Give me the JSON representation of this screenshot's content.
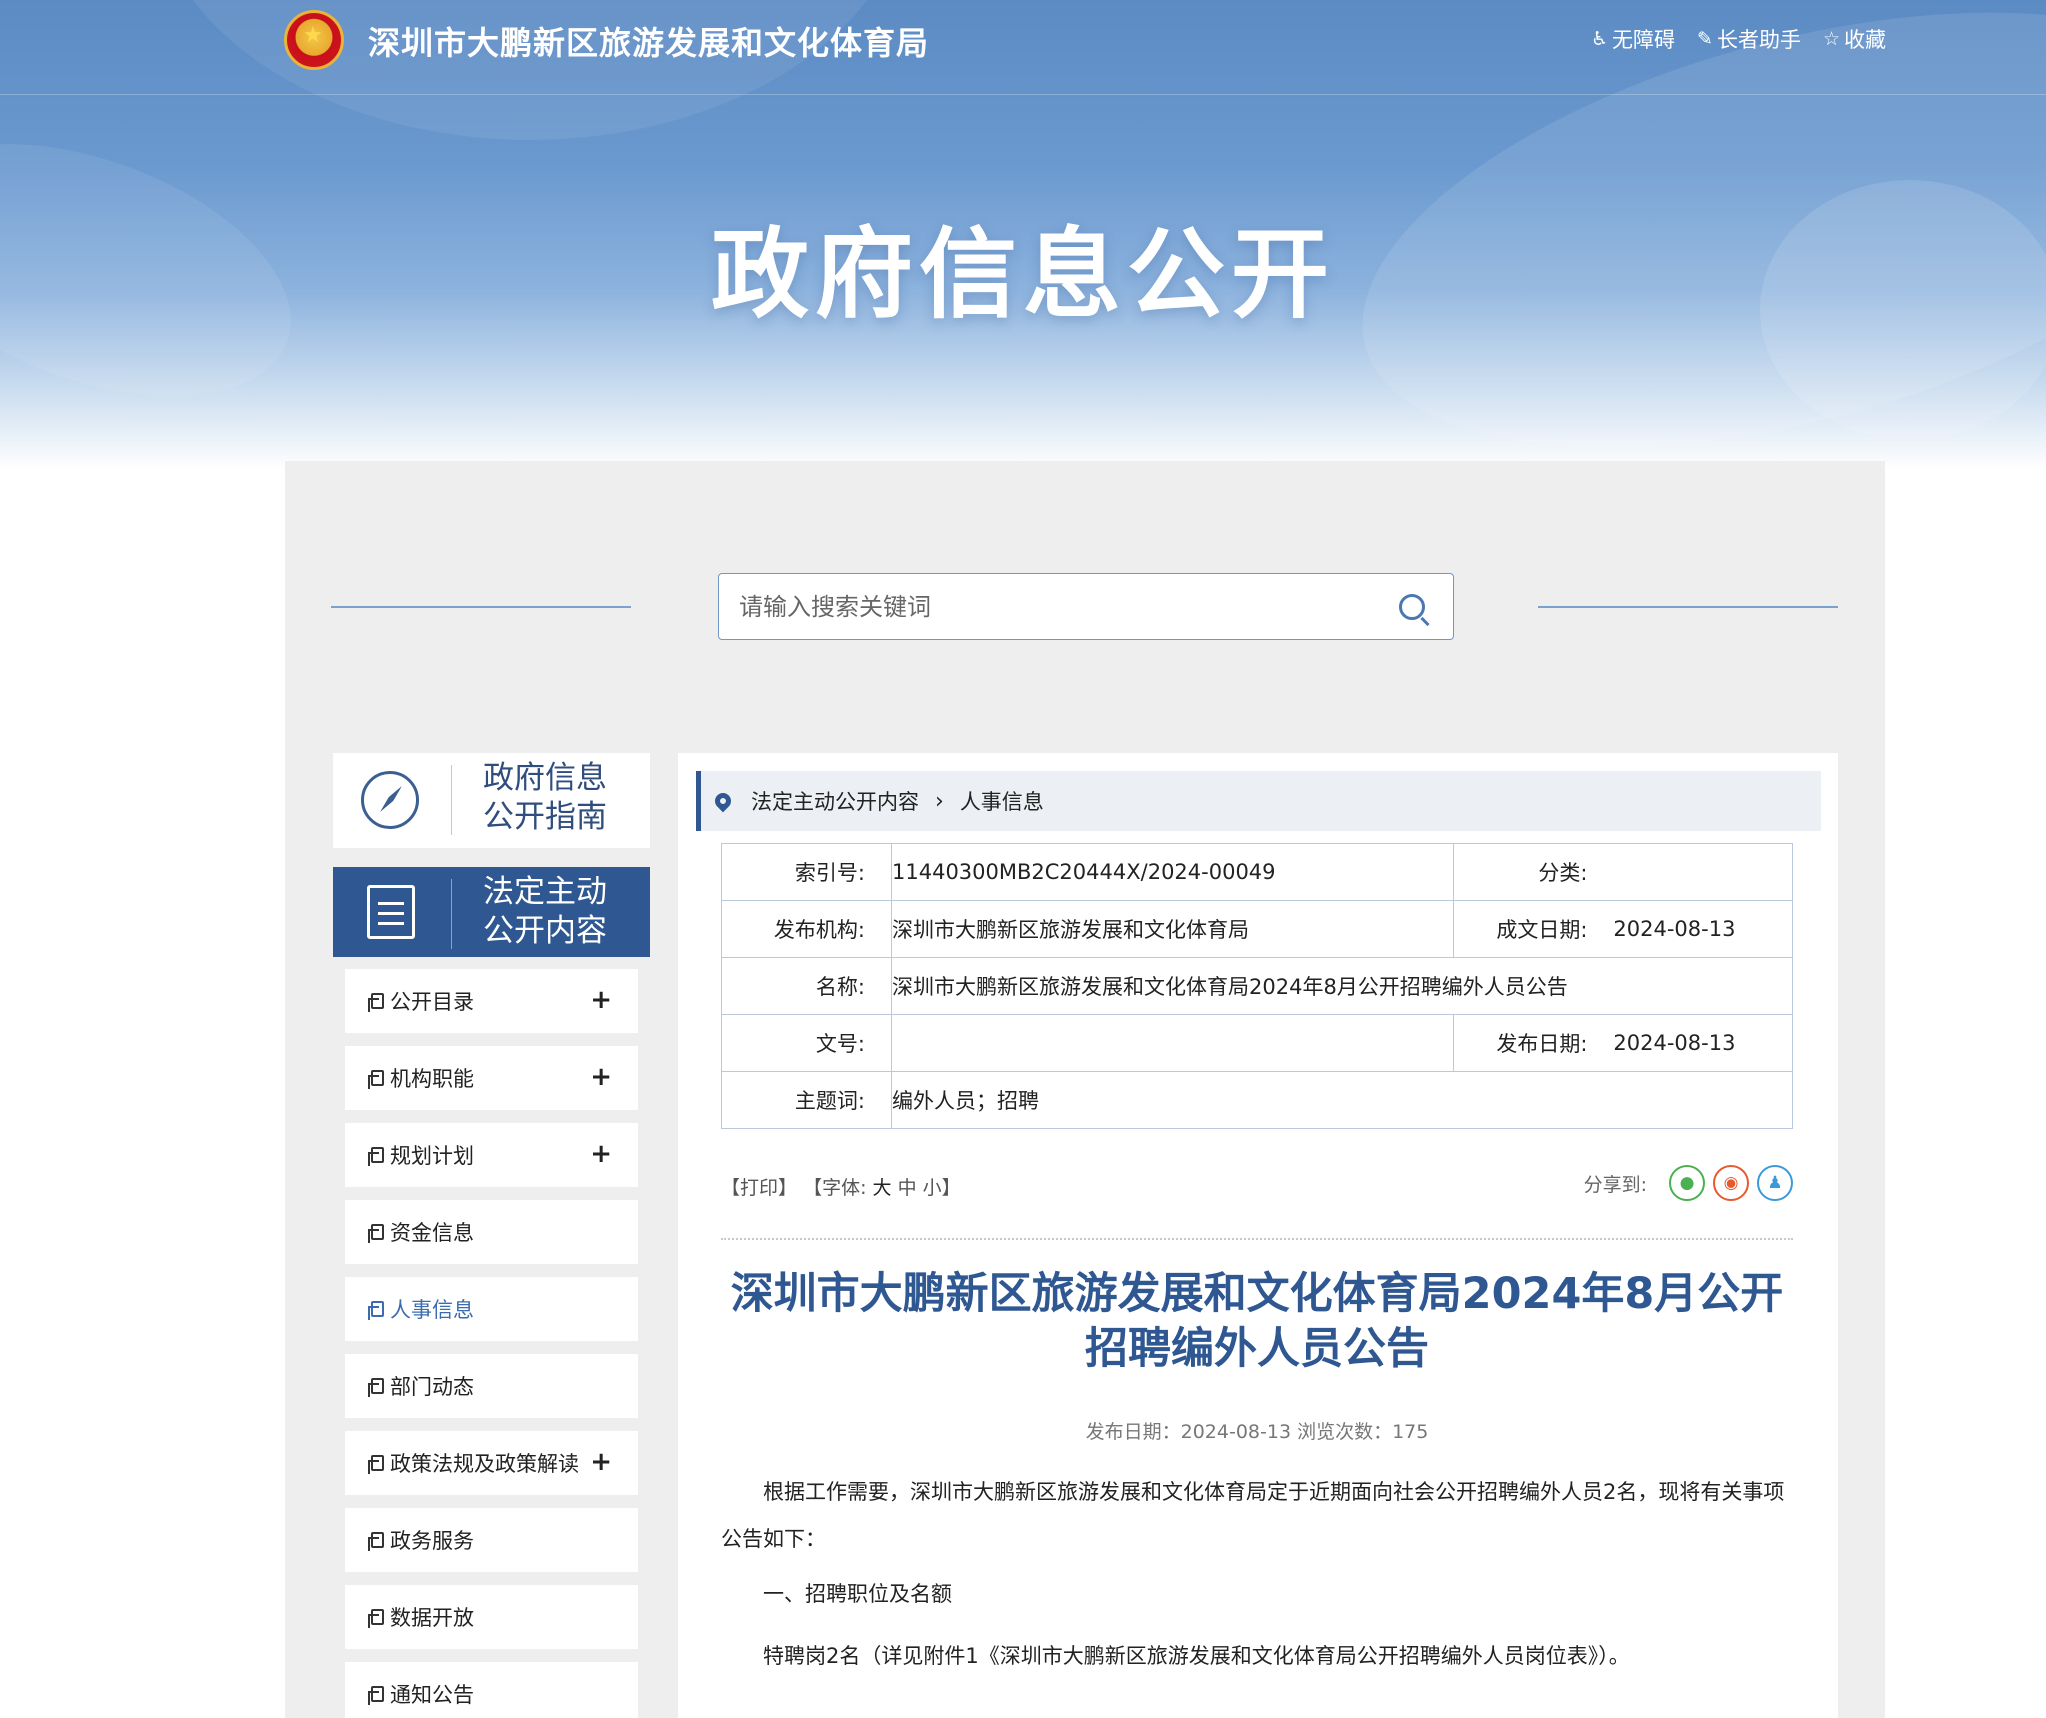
{
  "header": {
    "site_name": "深圳市大鹏新区旅游发展和文化体育局",
    "tools": [
      {
        "icon": "accessibility-icon",
        "label": "无障碍"
      },
      {
        "icon": "elder-helper-icon",
        "label": "长者助手"
      },
      {
        "icon": "star-icon",
        "label": "收藏"
      }
    ],
    "hero_title": "政府信息公开"
  },
  "search": {
    "placeholder": "请输入搜索关键词"
  },
  "sidebar": {
    "guide_label_1": "政府信息",
    "guide_label_2": "公开指南",
    "active_label_1": "法定主动",
    "active_label_2": "公开内容",
    "items": [
      {
        "label": "公开目录",
        "expandable": "+"
      },
      {
        "label": "机构职能",
        "expandable": "+"
      },
      {
        "label": "规划计划",
        "expandable": "+"
      },
      {
        "label": "资金信息",
        "expandable": ""
      },
      {
        "label": "人事信息",
        "expandable": ""
      },
      {
        "label": "部门动态",
        "expandable": ""
      },
      {
        "label": "政策法规及政策解读",
        "expandable": "+"
      },
      {
        "label": "政务服务",
        "expandable": ""
      },
      {
        "label": "数据开放",
        "expandable": ""
      },
      {
        "label": "通知公告",
        "expandable": ""
      }
    ]
  },
  "breadcrumb": {
    "parent": "法定主动公开内容",
    "separator": "›",
    "current": "人事信息"
  },
  "meta": {
    "index_label": "索引号:",
    "index_value": "11440300MB2C20444X/2024-00049",
    "category_label": "分类:",
    "category_value": "",
    "publisher_label": "发布机构:",
    "publisher_value": "深圳市大鹏新区旅游发展和文化体育局",
    "created_label": "成文日期:",
    "created_value": "2024-08-13",
    "name_label": "名称:",
    "name_value": "深圳市大鹏新区旅游发展和文化体育局2024年8月公开招聘编外人员公告",
    "docno_label": "文号:",
    "docno_value": "",
    "pubdate_label": "发布日期:",
    "pubdate_value": "2024-08-13",
    "keywords_label": "主题词:",
    "keywords_value": "编外人员；招聘"
  },
  "tools": {
    "print": "【打印】",
    "font_prefix": "【字体:",
    "font_large": "大",
    "font_medium": "中",
    "font_small": "小】",
    "share_label": "分享到:",
    "share_icons": [
      "wechat-icon",
      "weibo-icon",
      "qq-icon"
    ]
  },
  "article": {
    "title": "深圳市大鹏新区旅游发展和文化体育局2024年8月公开招聘编外人员公告",
    "publish_info": "发布日期：2024-08-13  浏览次数：175",
    "paragraphs": [
      "根据工作需要，深圳市大鹏新区旅游发展和文化体育局定于近期面向社会公开招聘编外人员2名，现将有关事项公告如下：",
      "一、招聘职位及名额",
      "特聘岗2名（详见附件1《深圳市大鹏新区旅游发展和文化体育局公开招聘编外人员岗位表》）。"
    ]
  }
}
